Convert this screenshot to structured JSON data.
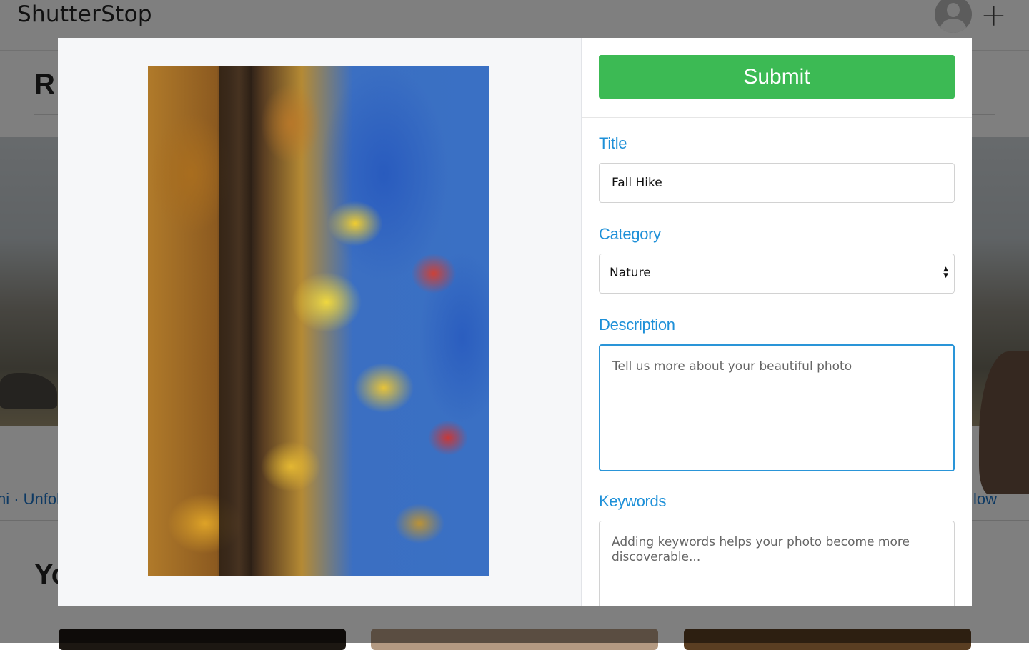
{
  "app": {
    "logo": "ShutterStop",
    "add_icon": "plus-icon",
    "avatar_icon": "user-avatar-icon"
  },
  "background": {
    "section_1_heading": "R",
    "section_2_heading": "Yo",
    "profile_left_text": "ni · Unfoll",
    "profile_right_text": "low"
  },
  "modal": {
    "submit_label": "Submit",
    "title": {
      "label": "Title",
      "value": "Fall Hike"
    },
    "category": {
      "label": "Category",
      "selected": "Nature"
    },
    "description": {
      "label": "Description",
      "placeholder": "Tell us more about your beautiful photo",
      "value": ""
    },
    "keywords": {
      "label": "Keywords",
      "placeholder": "Adding keywords helps your photo become more discoverable...",
      "value": ""
    }
  },
  "colors": {
    "submit": "#3cba54",
    "label": "#1e90d8",
    "focus_border": "#2a95d8",
    "link": "#1a73c7"
  }
}
